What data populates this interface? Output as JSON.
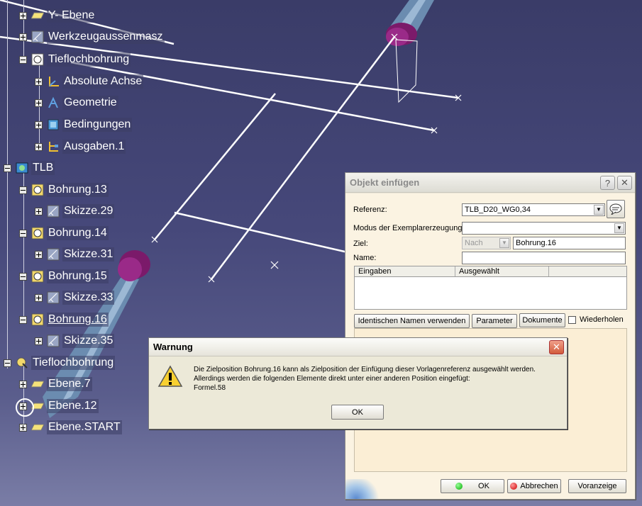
{
  "tree": {
    "items": [
      {
        "label": "Y- Ebene",
        "icon": "plane-icon"
      },
      {
        "label": "Werkzeugaussenmasz",
        "icon": "sketch-icon"
      },
      {
        "label": "Tieflochbohrung",
        "icon": "feature-icon"
      },
      {
        "label": "Absolute Achse",
        "icon": "axis-icon"
      },
      {
        "label": "Geometrie",
        "icon": "geometry-icon"
      },
      {
        "label": "Bedingungen",
        "icon": "constraints-icon"
      },
      {
        "label": "Ausgaben.1",
        "icon": "outputs-icon"
      },
      {
        "label": "TLB",
        "icon": "assembly-icon"
      },
      {
        "label": "Bohrung.13",
        "icon": "hole-icon"
      },
      {
        "label": "Skizze.29",
        "icon": "sketch-icon"
      },
      {
        "label": "Bohrung.14",
        "icon": "hole-icon"
      },
      {
        "label": "Skizze.31",
        "icon": "sketch-icon"
      },
      {
        "label": "Bohrung.15",
        "icon": "hole-icon"
      },
      {
        "label": "Skizze.33",
        "icon": "sketch-icon"
      },
      {
        "label": "Bohrung.16",
        "icon": "hole-icon"
      },
      {
        "label": "Skizze.35",
        "icon": "sketch-icon"
      },
      {
        "label": "Tieflochbohrung",
        "icon": "pointer-icon"
      },
      {
        "label": "Ebene.7",
        "icon": "plane-icon"
      },
      {
        "label": "Ebene.12",
        "icon": "plane-icon"
      },
      {
        "label": "Ebene.START",
        "icon": "plane-icon"
      }
    ]
  },
  "insert_dialog": {
    "title": "Objekt einfügen",
    "help": "?",
    "close": "✕",
    "referenz_label": "Referenz:",
    "referenz_value": "TLB_D20_WG0,34",
    "modus_label": "Modus der Exemplarerzeugung:",
    "modus_value": "",
    "ziel_label": "Ziel:",
    "ziel_mode": "Nach",
    "ziel_value": "Bohrung.16",
    "name_label": "Name:",
    "name_value": "",
    "col_eingaben": "Eingaben",
    "col_ausgewaehlt": "Ausgewählt",
    "btn_identical": "Identischen Namen verwenden",
    "btn_parameter": "Parameter",
    "btn_dokumente": "Dokumente",
    "chk_wiederholen": "Wiederholen",
    "btn_ok": "OK",
    "btn_abbrechen": "Abbrechen",
    "btn_vorschau": "Voranzeige"
  },
  "warning": {
    "title": "Warnung",
    "close": "✕",
    "line1": "Die Zielposition Bohrung.16 kann als Zielposition der Einfügung dieser Vorlagenreferenz ausgewählt werden.",
    "line2": "Allerdings werden die folgenden Elemente direkt unter einer anderen Position eingefügt:",
    "line3": "Formel.58",
    "ok": "OK"
  },
  "colors": {
    "background": "#46487a",
    "tree_text": "#ffffff",
    "pipe": "#6f8fb0",
    "flange": "#8a1a7a",
    "warning_close": "#d94a2a"
  }
}
